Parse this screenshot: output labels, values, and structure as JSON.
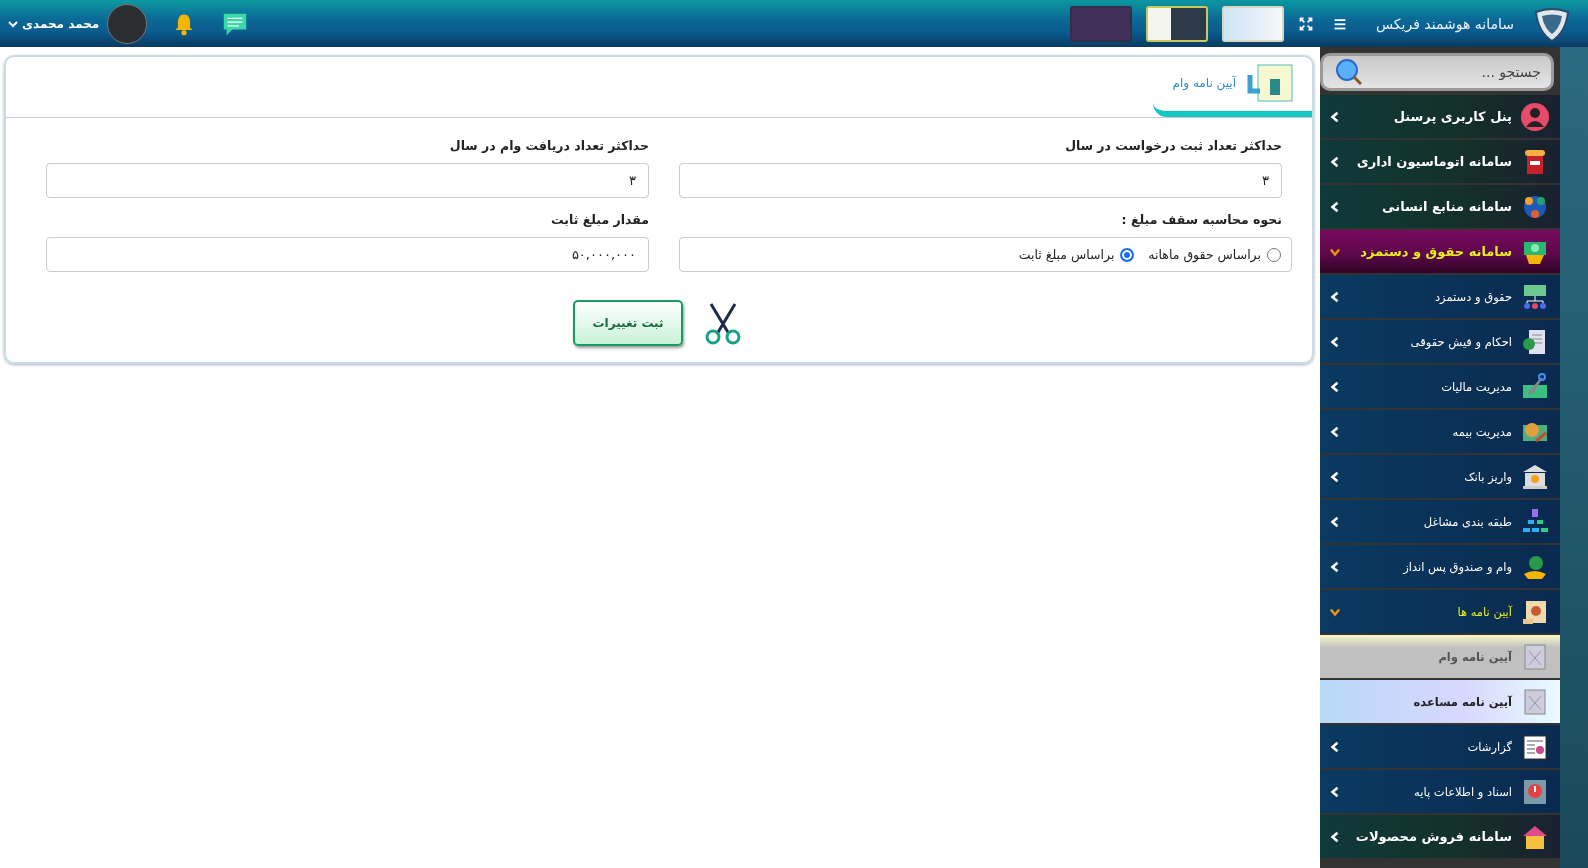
{
  "header": {
    "title": "سامانه هوشمند فریکس",
    "user_name": "محمد محمدی"
  },
  "sidebar": {
    "search": {
      "placeholder": "جستجو ..."
    },
    "items": [
      {
        "kind": "system",
        "label": "پنل کاربری پرسنل",
        "expanded": false
      },
      {
        "kind": "system",
        "label": "سامانه اتوماسیون اداری",
        "expanded": false
      },
      {
        "kind": "system",
        "label": "سامانه منابع انسانی",
        "expanded": false
      },
      {
        "kind": "system",
        "label": "سامانه حقوق و دستمزد",
        "expanded": true,
        "children": [
          {
            "kind": "module",
            "label": "حقوق و دستمزد",
            "expanded": false
          },
          {
            "kind": "module",
            "label": "احکام و فیش حقوقی",
            "expanded": false
          },
          {
            "kind": "module",
            "label": "مدیریت مالیات",
            "expanded": false
          },
          {
            "kind": "module",
            "label": "مدیریت بیمه",
            "expanded": false
          },
          {
            "kind": "module",
            "label": "واریز بانک",
            "expanded": false
          },
          {
            "kind": "module",
            "label": "طبقه بندی مشاغل",
            "expanded": false
          },
          {
            "kind": "module",
            "label": "وام و صندوق پس انداز",
            "expanded": false
          },
          {
            "kind": "module",
            "label": "آیین نامه ها",
            "expanded": true,
            "children": [
              {
                "kind": "page",
                "label": "آیین نامه وام",
                "selected": true
              },
              {
                "kind": "page",
                "label": "آیین نامه مساعده",
                "selected": false
              }
            ]
          },
          {
            "kind": "module",
            "label": "گزارشات",
            "expanded": false
          },
          {
            "kind": "module",
            "label": "اسناد و اطلاعات پایه",
            "expanded": false
          }
        ]
      },
      {
        "kind": "system",
        "label": "سامانه فروش محصولات",
        "expanded": false
      }
    ]
  },
  "card": {
    "tab": {
      "label": "آیین نامه وام"
    },
    "fields": [
      {
        "kind": "text",
        "label": "حداکثر تعداد ثبت درخواست در سال",
        "value": "۳"
      },
      {
        "kind": "text",
        "label": "حداکثر تعداد دریافت وام در سال",
        "value": "۳"
      },
      {
        "kind": "radio",
        "label": "نحوه محاسبه سقف مبلغ :",
        "options": [
          {
            "label": "براساس حقوق ماهانه",
            "selected": false
          },
          {
            "label": "براساس مبلغ ثابت",
            "selected": true
          }
        ]
      },
      {
        "kind": "text",
        "label": "مقدار مبلغ ثابت",
        "value": "۵۰,۰۰۰,۰۰۰"
      }
    ],
    "submit": "ثبت تغییرات"
  }
}
